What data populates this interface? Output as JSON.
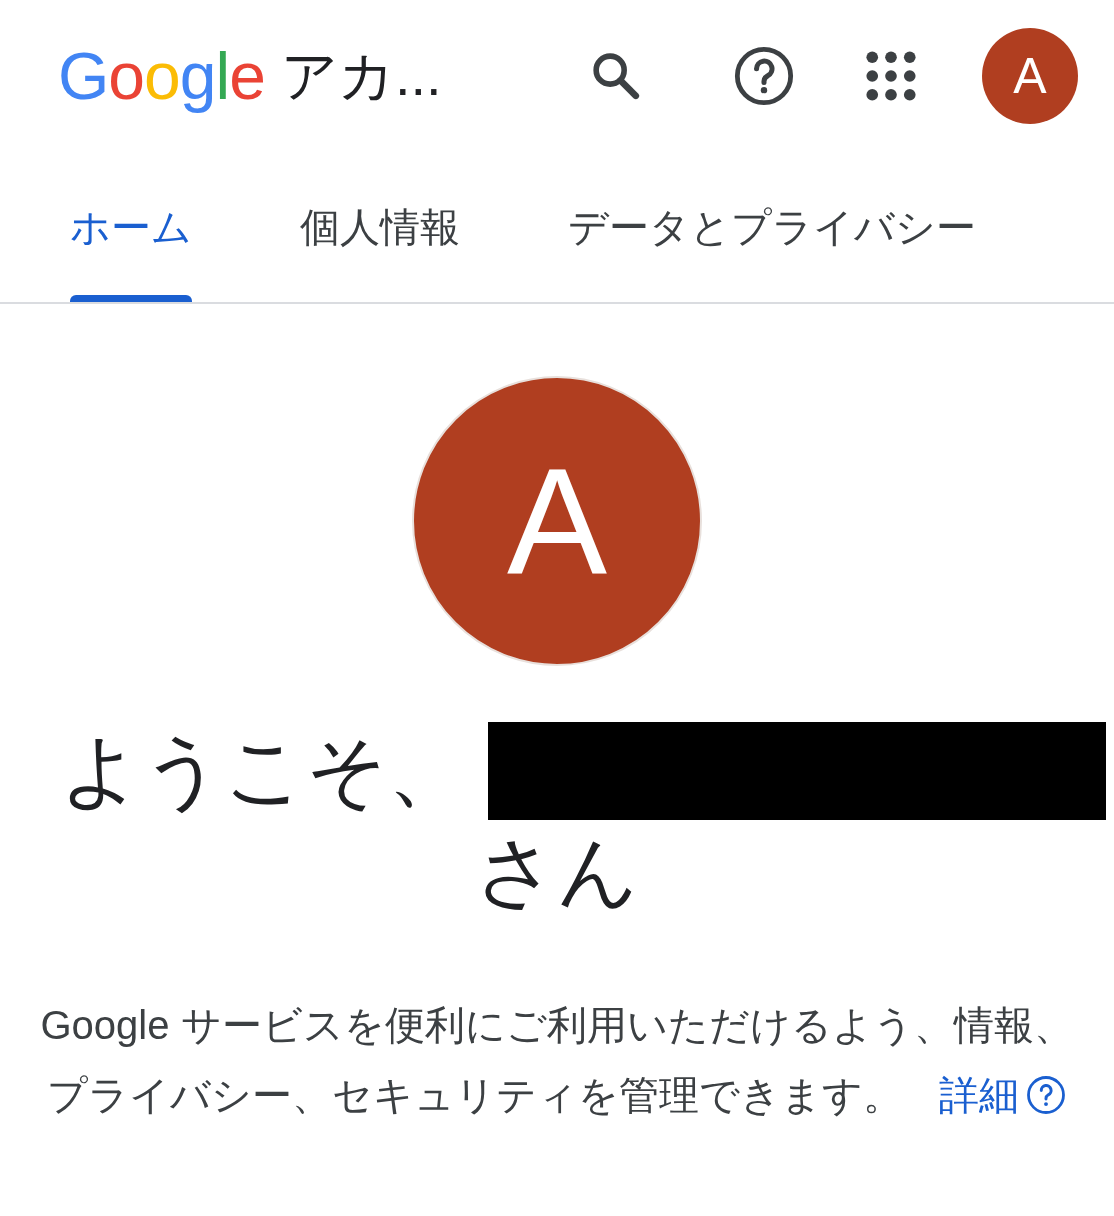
{
  "header": {
    "logo": "Google",
    "title": "アカ..."
  },
  "tabs": [
    {
      "label": "ホーム",
      "selected": true
    },
    {
      "label": "個人情報",
      "selected": false
    },
    {
      "label": "データとプライバシー",
      "selected": false
    }
  ],
  "profile": {
    "initial": "A",
    "color": "#b03e20"
  },
  "account_avatar": {
    "initial": "A",
    "color": "#b03e20"
  },
  "welcome": {
    "greeting": "ようこそ、",
    "name_redacted": true,
    "suffix": "さん"
  },
  "description": {
    "text": "Google サービスを便利にご利用いただけるよう、情報、プライバシー、セキュリティを管理できます。",
    "link": "詳細"
  }
}
